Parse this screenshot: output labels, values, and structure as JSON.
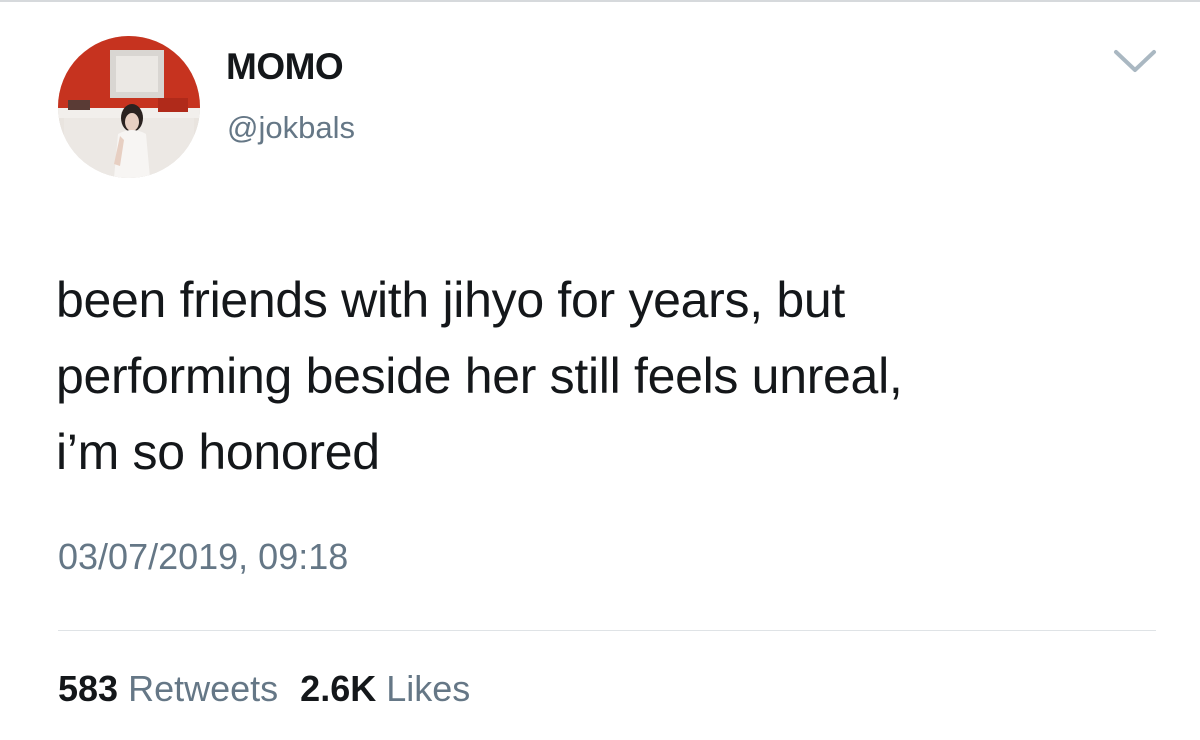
{
  "author": {
    "display_name": "MOMO",
    "handle": "@jokbals",
    "avatar_icon": "profile-photo"
  },
  "menu": {
    "icon": "chevron-down-icon"
  },
  "tweet": {
    "text_lines": [
      "been friends with jihyo for years, but",
      "performing beside her still feels unreal,",
      "i’m so honored"
    ],
    "timestamp": "03/07/2019, 09:18"
  },
  "stats": {
    "retweets_count": "583",
    "retweets_label": "Retweets",
    "likes_count": "2.6K",
    "likes_label": "Likes"
  },
  "colors": {
    "text_primary": "#14171a",
    "text_secondary": "#657786",
    "divider": "#dfe3e6"
  }
}
